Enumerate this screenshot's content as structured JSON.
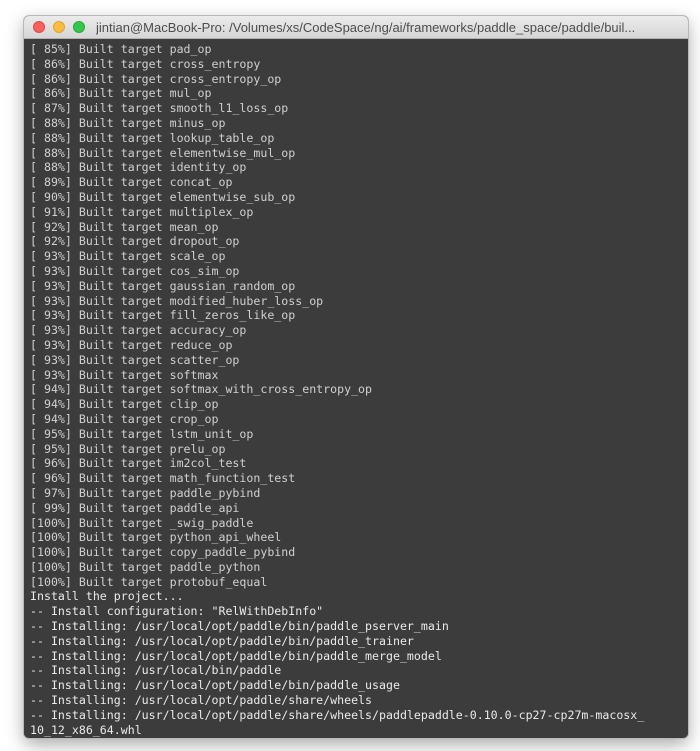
{
  "window": {
    "title": "jintian@MacBook-Pro: /Volumes/xs/CodeSpace/ng/ai/frameworks/paddle_space/paddle/buil..."
  },
  "terminal": {
    "lines": [
      "[ 85%] Built target pad_op",
      "[ 86%] Built target cross_entropy",
      "[ 86%] Built target cross_entropy_op",
      "[ 86%] Built target mul_op",
      "[ 87%] Built target smooth_l1_loss_op",
      "[ 88%] Built target minus_op",
      "[ 88%] Built target lookup_table_op",
      "[ 88%] Built target elementwise_mul_op",
      "[ 88%] Built target identity_op",
      "[ 89%] Built target concat_op",
      "[ 90%] Built target elementwise_sub_op",
      "[ 91%] Built target multiplex_op",
      "[ 92%] Built target mean_op",
      "[ 92%] Built target dropout_op",
      "[ 93%] Built target scale_op",
      "[ 93%] Built target cos_sim_op",
      "[ 93%] Built target gaussian_random_op",
      "[ 93%] Built target modified_huber_loss_op",
      "[ 93%] Built target fill_zeros_like_op",
      "[ 93%] Built target accuracy_op",
      "[ 93%] Built target reduce_op",
      "[ 93%] Built target scatter_op",
      "[ 93%] Built target softmax",
      "[ 94%] Built target softmax_with_cross_entropy_op",
      "[ 94%] Built target clip_op",
      "[ 94%] Built target crop_op",
      "[ 95%] Built target lstm_unit_op",
      "[ 95%] Built target prelu_op",
      "[ 96%] Built target im2col_test",
      "[ 96%] Built target math_function_test",
      "[ 97%] Built target paddle_pybind",
      "[ 99%] Built target paddle_api",
      "[100%] Built target _swig_paddle",
      "[100%] Built target python_api_wheel",
      "[100%] Built target copy_paddle_pybind",
      "[100%] Built target paddle_python",
      "[100%] Built target protobuf_equal",
      "Install the project...",
      "-- Install configuration: \"RelWithDebInfo\"",
      "-- Installing: /usr/local/opt/paddle/bin/paddle_pserver_main",
      "-- Installing: /usr/local/opt/paddle/bin/paddle_trainer",
      "-- Installing: /usr/local/opt/paddle/bin/paddle_merge_model",
      "-- Installing: /usr/local/bin/paddle",
      "-- Installing: /usr/local/opt/paddle/bin/paddle_usage",
      "-- Installing: /usr/local/opt/paddle/share/wheels",
      "-- Installing: /usr/local/opt/paddle/share/wheels/paddlepaddle-0.10.0-cp27-cp27m-macosx_",
      "10_12_x86_64.whl"
    ]
  }
}
